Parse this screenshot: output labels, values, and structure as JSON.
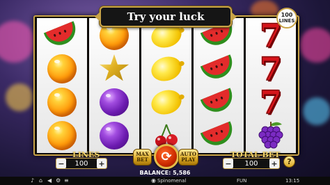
{
  "game": {
    "title": "Try your luck",
    "lines_badge": {
      "number": "100",
      "label": "LINES"
    }
  },
  "reels": [
    [
      "watermelon",
      "orange",
      "orange",
      "orange"
    ],
    [
      "orange",
      "star",
      "plum",
      "plum"
    ],
    [
      "lemon",
      "lemon",
      "lemon",
      "cherry"
    ],
    [
      "watermelon",
      "watermelon",
      "watermelon",
      "watermelon"
    ],
    [
      "seven",
      "seven",
      "seven",
      "grapes"
    ]
  ],
  "seven_glyph": "7",
  "controls": {
    "lines_label": "LINES",
    "lines_value": "100",
    "total_bet_label": "TOTAL BET",
    "total_bet_value": "100",
    "minus": "−",
    "plus": "+",
    "max_bet_label": "MAX BET",
    "auto_play_label": "AUTO PLAY",
    "spin_glyph": "⟳",
    "info_glyph": "?"
  },
  "balance": "BALANCE: 5,586",
  "footer": {
    "brand": "Spinomenal",
    "currency": "FUN",
    "time": "13:15"
  },
  "colors": {
    "gold": "#c9a447",
    "banner_bg": "#151515",
    "seven_red": "#d4141a"
  }
}
